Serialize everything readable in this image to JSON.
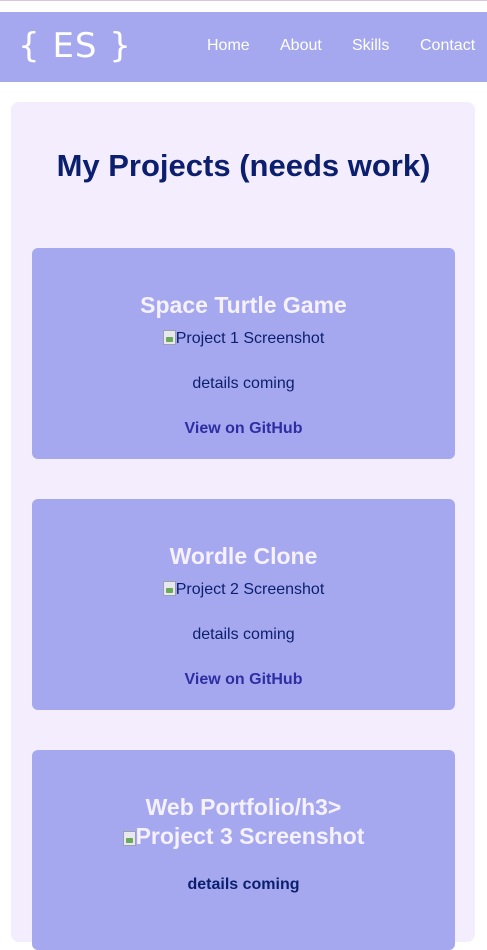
{
  "nav": {
    "logo": "{ ES }",
    "links": [
      "Home",
      "About",
      "Skills",
      "Contact"
    ]
  },
  "page": {
    "title": "My Projects (needs work)"
  },
  "projects": [
    {
      "title": "Space Turtle Game",
      "screenshot_alt": "Project 1 Screenshot",
      "details": "details coming",
      "link": "View on GitHub"
    },
    {
      "title": "Wordle Clone",
      "screenshot_alt": "Project 2 Screenshot",
      "details": "details coming",
      "link": "View on GitHub"
    },
    {
      "title": "Web Portfolio/h3>",
      "screenshot_alt": "Project 3 Screenshot",
      "details": "details coming"
    }
  ],
  "colors": {
    "nav_bg": "#a5a8ee",
    "panel_bg": "#f3edfd",
    "title": "#0c1f6f",
    "card_bg": "#a5a8ee",
    "link": "#2e2ea3"
  }
}
